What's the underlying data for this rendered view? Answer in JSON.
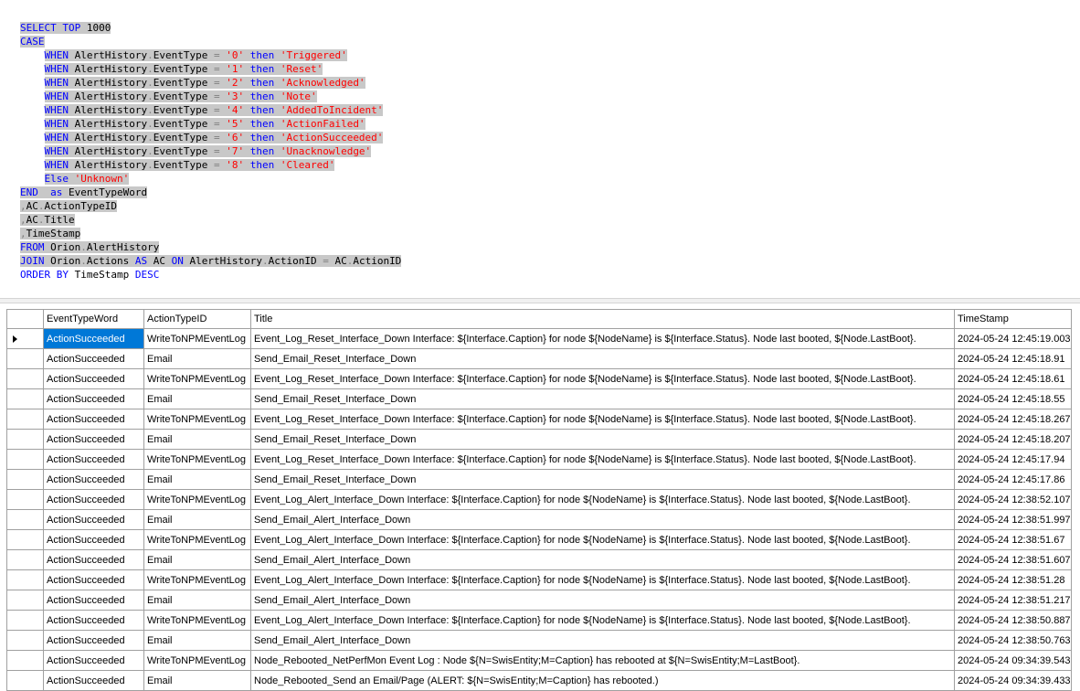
{
  "editor": {
    "lines": [
      "SELECT TOP 1000",
      "CASE",
      "    WHEN AlertHistory.EventType = '0' then 'Triggered'",
      "    WHEN AlertHistory.EventType = '1' then 'Reset'",
      "    WHEN AlertHistory.EventType = '2' then 'Acknowledged'",
      "    WHEN AlertHistory.EventType = '3' then 'Note'",
      "    WHEN AlertHistory.EventType = '4' then 'AddedToIncident'",
      "    WHEN AlertHistory.EventType = '5' then 'ActionFailed'",
      "    WHEN AlertHistory.EventType = '6' then 'ActionSucceeded'",
      "    WHEN AlertHistory.EventType = '7' then 'Unacknowledge'",
      "    WHEN AlertHistory.EventType = '8' then 'Cleared'",
      "    Else 'Unknown'",
      "END  as EventTypeWord",
      ",AC.ActionTypeID",
      ",AC.Title",
      ",TimeStamp",
      "FROM Orion.AlertHistory",
      "JOIN Orion.Actions AS AC ON AlertHistory.ActionID = AC.ActionID",
      "ORDER BY TimeStamp DESC"
    ]
  },
  "grid": {
    "columns": [
      "EventTypeWord",
      "ActionTypeID",
      "Title",
      "TimeStamp"
    ],
    "rows": [
      [
        "ActionSucceeded",
        "WriteToNPMEventLog",
        "Event_Log_Reset_Interface_Down Interface: ${Interface.Caption} for node ${NodeName} is ${Interface.Status}. Node last booted, ${Node.LastBoot}.",
        "2024-05-24 12:45:19.003"
      ],
      [
        "ActionSucceeded",
        "Email",
        "Send_Email_Reset_Interface_Down",
        "2024-05-24 12:45:18.91"
      ],
      [
        "ActionSucceeded",
        "WriteToNPMEventLog",
        "Event_Log_Reset_Interface_Down Interface: ${Interface.Caption} for node ${NodeName} is ${Interface.Status}. Node last booted, ${Node.LastBoot}.",
        "2024-05-24 12:45:18.61"
      ],
      [
        "ActionSucceeded",
        "Email",
        "Send_Email_Reset_Interface_Down",
        "2024-05-24 12:45:18.55"
      ],
      [
        "ActionSucceeded",
        "WriteToNPMEventLog",
        "Event_Log_Reset_Interface_Down Interface: ${Interface.Caption} for node ${NodeName} is ${Interface.Status}. Node last booted, ${Node.LastBoot}.",
        "2024-05-24 12:45:18.267"
      ],
      [
        "ActionSucceeded",
        "Email",
        "Send_Email_Reset_Interface_Down",
        "2024-05-24 12:45:18.207"
      ],
      [
        "ActionSucceeded",
        "WriteToNPMEventLog",
        "Event_Log_Reset_Interface_Down Interface: ${Interface.Caption} for node ${NodeName} is ${Interface.Status}. Node last booted, ${Node.LastBoot}.",
        "2024-05-24 12:45:17.94"
      ],
      [
        "ActionSucceeded",
        "Email",
        "Send_Email_Reset_Interface_Down",
        "2024-05-24 12:45:17.86"
      ],
      [
        "ActionSucceeded",
        "WriteToNPMEventLog",
        "Event_Log_Alert_Interface_Down Interface: ${Interface.Caption} for node ${NodeName} is ${Interface.Status}. Node last booted, ${Node.LastBoot}.",
        "2024-05-24 12:38:52.107"
      ],
      [
        "ActionSucceeded",
        "Email",
        "Send_Email_Alert_Interface_Down",
        "2024-05-24 12:38:51.997"
      ],
      [
        "ActionSucceeded",
        "WriteToNPMEventLog",
        "Event_Log_Alert_Interface_Down Interface: ${Interface.Caption} for node ${NodeName} is ${Interface.Status}. Node last booted, ${Node.LastBoot}.",
        "2024-05-24 12:38:51.67"
      ],
      [
        "ActionSucceeded",
        "Email",
        "Send_Email_Alert_Interface_Down",
        "2024-05-24 12:38:51.607"
      ],
      [
        "ActionSucceeded",
        "WriteToNPMEventLog",
        "Event_Log_Alert_Interface_Down Interface: ${Interface.Caption} for node ${NodeName} is ${Interface.Status}. Node last booted, ${Node.LastBoot}.",
        "2024-05-24 12:38:51.28"
      ],
      [
        "ActionSucceeded",
        "Email",
        "Send_Email_Alert_Interface_Down",
        "2024-05-24 12:38:51.217"
      ],
      [
        "ActionSucceeded",
        "WriteToNPMEventLog",
        "Event_Log_Alert_Interface_Down Interface: ${Interface.Caption} for node ${NodeName} is ${Interface.Status}. Node last booted, ${Node.LastBoot}.",
        "2024-05-24 12:38:50.887"
      ],
      [
        "ActionSucceeded",
        "Email",
        "Send_Email_Alert_Interface_Down",
        "2024-05-24 12:38:50.763"
      ],
      [
        "ActionSucceeded",
        "WriteToNPMEventLog",
        "Node_Rebooted_NetPerfMon Event Log : Node ${N=SwisEntity;M=Caption} has rebooted at ${N=SwisEntity;M=LastBoot}.",
        "2024-05-24 09:34:39.543"
      ],
      [
        "ActionSucceeded",
        "Email",
        "Node_Rebooted_Send an Email/Page (ALERT: ${N=SwisEntity;M=Caption} has rebooted.)",
        "2024-05-24 09:34:39.433"
      ]
    ],
    "selected_row": 0
  },
  "colors": {
    "keyword": "#0000ff",
    "string": "#ff0000",
    "operator": "#808080",
    "selection_text_bg": "#c8c8c8",
    "selected_cell": "#0078d7"
  },
  "icons": {
    "current_row": "row-pointer-icon"
  }
}
